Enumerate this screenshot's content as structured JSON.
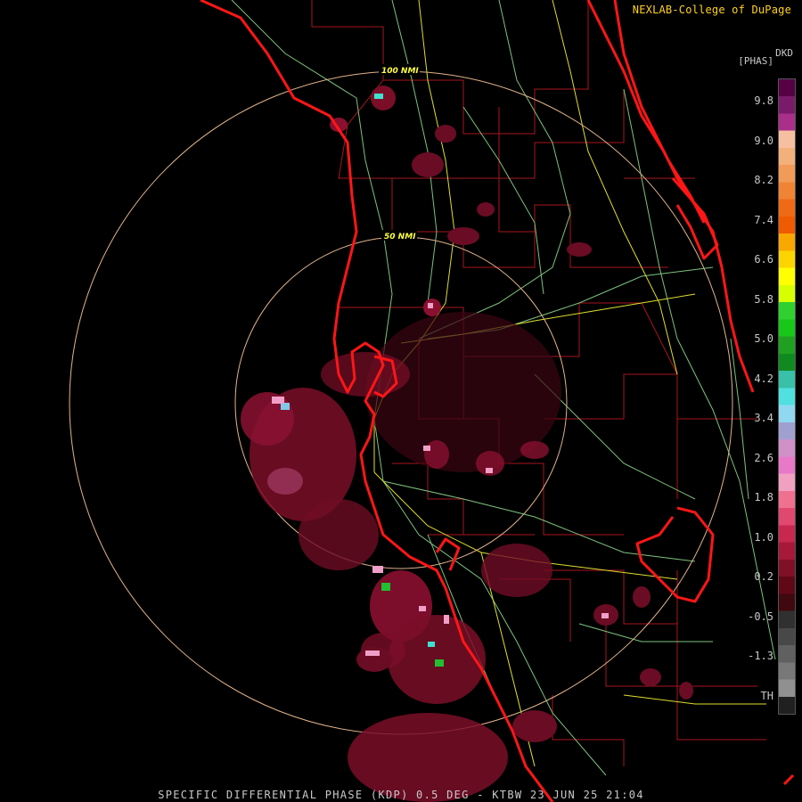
{
  "credit": "NEXLAB-College of DuPage",
  "product_code": "DKD",
  "unit": "[PHAS]",
  "footer": "SPECIFIC DIFFERENTIAL PHASE (KDP) 0.5 DEG - KTBW 23 JUN 25 21:04",
  "range_rings": [
    {
      "label": "100 NMI"
    },
    {
      "label": "50 NMI"
    }
  ],
  "legend": {
    "labels": [
      "9.8",
      "9.0",
      "8.2",
      "7.4",
      "6.6",
      "5.8",
      "5.0",
      "4.2",
      "3.4",
      "2.6",
      "1.8",
      "1.0",
      "0.2",
      "-0.5",
      "-1.3",
      "TH"
    ],
    "colors": [
      "#560045",
      "#7a1a6b",
      "#aa2e8a",
      "#f6c0a0",
      "#f4b07a",
      "#f29a58",
      "#f08434",
      "#f06a16",
      "#f05a00",
      "#f8a800",
      "#fcd400",
      "#ffff00",
      "#d8ff00",
      "#30d030",
      "#18c818",
      "#20a020",
      "#108a20",
      "#38c0a8",
      "#50e0e0",
      "#90d8f0",
      "#a0a0d0",
      "#d090c8",
      "#e878c8",
      "#f0a0c0",
      "#f07090",
      "#e04870",
      "#c82850",
      "#a81838",
      "#801028",
      "#600818",
      "#400810",
      "#303030",
      "#484848",
      "#606060",
      "#787878",
      "#909090",
      "#202020"
    ]
  },
  "colors": {
    "background": "#000000",
    "coast": "#ff1a1a",
    "county": "#b01818",
    "highway": "#e8e838",
    "road": "#80c080",
    "ring": "#e0b090",
    "echo": "#8a0f2a",
    "echo_bright": "#f070b0"
  }
}
